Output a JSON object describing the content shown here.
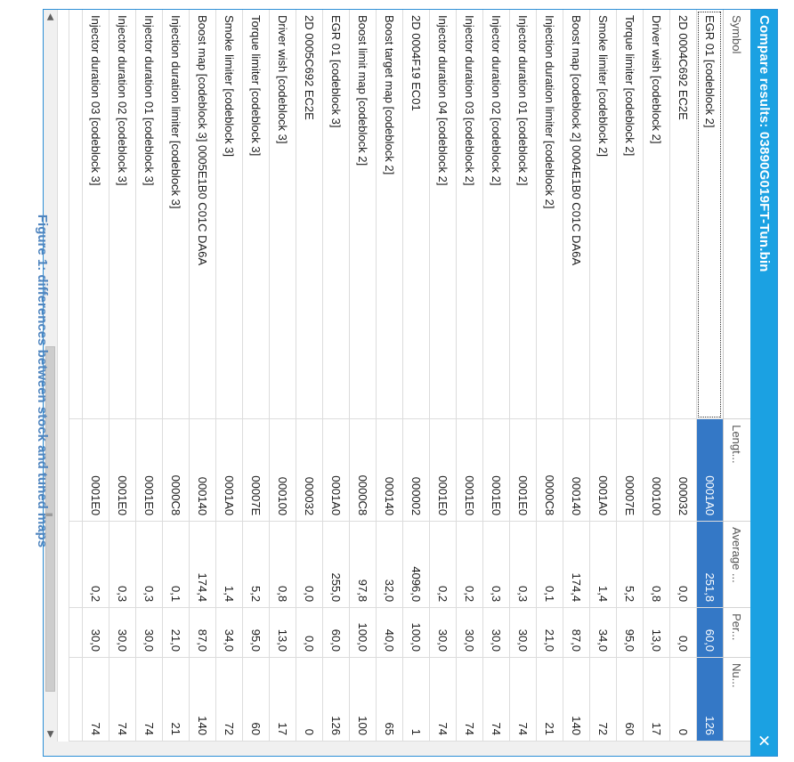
{
  "window": {
    "title": "Compare results: 03890G019FT-Tun.bin",
    "close_glyph": "✕"
  },
  "caption": "Figure 1: differences between stock and tuned maps",
  "table": {
    "columns": [
      "Symbol",
      "Lengt...",
      "Average ...",
      "Per...",
      "Nu..."
    ],
    "selected_row": 0,
    "rows": [
      [
        "EGR 01 [codeblock 2]",
        "0001A0",
        "251,8",
        "60,0",
        "126"
      ],
      [
        "2D 0004C692 EC2E",
        "000032",
        "0,0",
        "0,0",
        "0"
      ],
      [
        "Driver wish [codeblock 2]",
        "000100",
        "0,8",
        "13,0",
        "17"
      ],
      [
        "Torque limiter [codeblock 2]",
        "00007E",
        "5,2",
        "95,0",
        "60"
      ],
      [
        "Smoke limiter [codeblock 2]",
        "0001A0",
        "1,4",
        "34,0",
        "72"
      ],
      [
        "Boost map [codeblock 2] 0004E1B0 C01C DA6A",
        "000140",
        "174,4",
        "87,0",
        "140"
      ],
      [
        "Injection duration limiter [codeblock 2]",
        "0000C8",
        "0,1",
        "21,0",
        "21"
      ],
      [
        "Injector duration 01 [codeblock 2]",
        "0001E0",
        "0,3",
        "30,0",
        "74"
      ],
      [
        "Injector duration 02 [codeblock 2]",
        "0001E0",
        "0,3",
        "30,0",
        "74"
      ],
      [
        "Injector duration 03 [codeblock 2]",
        "0001E0",
        "0,2",
        "30,0",
        "74"
      ],
      [
        "Injector duration 04 [codeblock 2]",
        "0001E0",
        "0,2",
        "30,0",
        "74"
      ],
      [
        "2D 0004F19 EC01",
        "000002",
        "4096,0",
        "100,0",
        "1"
      ],
      [
        "Boost target map [codeblock 2]",
        "000140",
        "32,0",
        "40,0",
        "65"
      ],
      [
        "Boost limit map [codeblock 2]",
        "0000C8",
        "97,8",
        "100,0",
        "100"
      ],
      [
        "EGR 01 [codeblock 3]",
        "0001A0",
        "255,0",
        "60,0",
        "126"
      ],
      [
        "2D 0005C692 EC2E",
        "000032",
        "0,0",
        "0,0",
        "0"
      ],
      [
        "Driver wish [codeblock 3]",
        "000100",
        "0,8",
        "13,0",
        "17"
      ],
      [
        "Torque limiter [codeblock 3]",
        "00007E",
        "5,2",
        "95,0",
        "60"
      ],
      [
        "Smoke limiter [codeblock 3]",
        "0001A0",
        "1,4",
        "34,0",
        "72"
      ],
      [
        "Boost map [codeblock 3] 0005E1B0 C01C DA6A",
        "000140",
        "174,4",
        "87,0",
        "140"
      ],
      [
        "Injection duration limiter [codeblock 3]",
        "0000C8",
        "0,1",
        "21,0",
        "21"
      ],
      [
        "Injector duration 01 [codeblock 3]",
        "0001E0",
        "0,3",
        "30,0",
        "74"
      ],
      [
        "Injector duration 02 [codeblock 3]",
        "0001E0",
        "0,3",
        "30,0",
        "74"
      ],
      [
        "Injector duration 03 [codeblock 3]",
        "0001E0",
        "0,2",
        "30,0",
        "74"
      ]
    ]
  },
  "scrollbar": {
    "left_arrow": "◀",
    "right_arrow": "▶",
    "grip": "|||"
  },
  "colors": {
    "titlebar": "#1ba1e2",
    "selection": "#3478c6",
    "caption": "#4f85bf"
  }
}
